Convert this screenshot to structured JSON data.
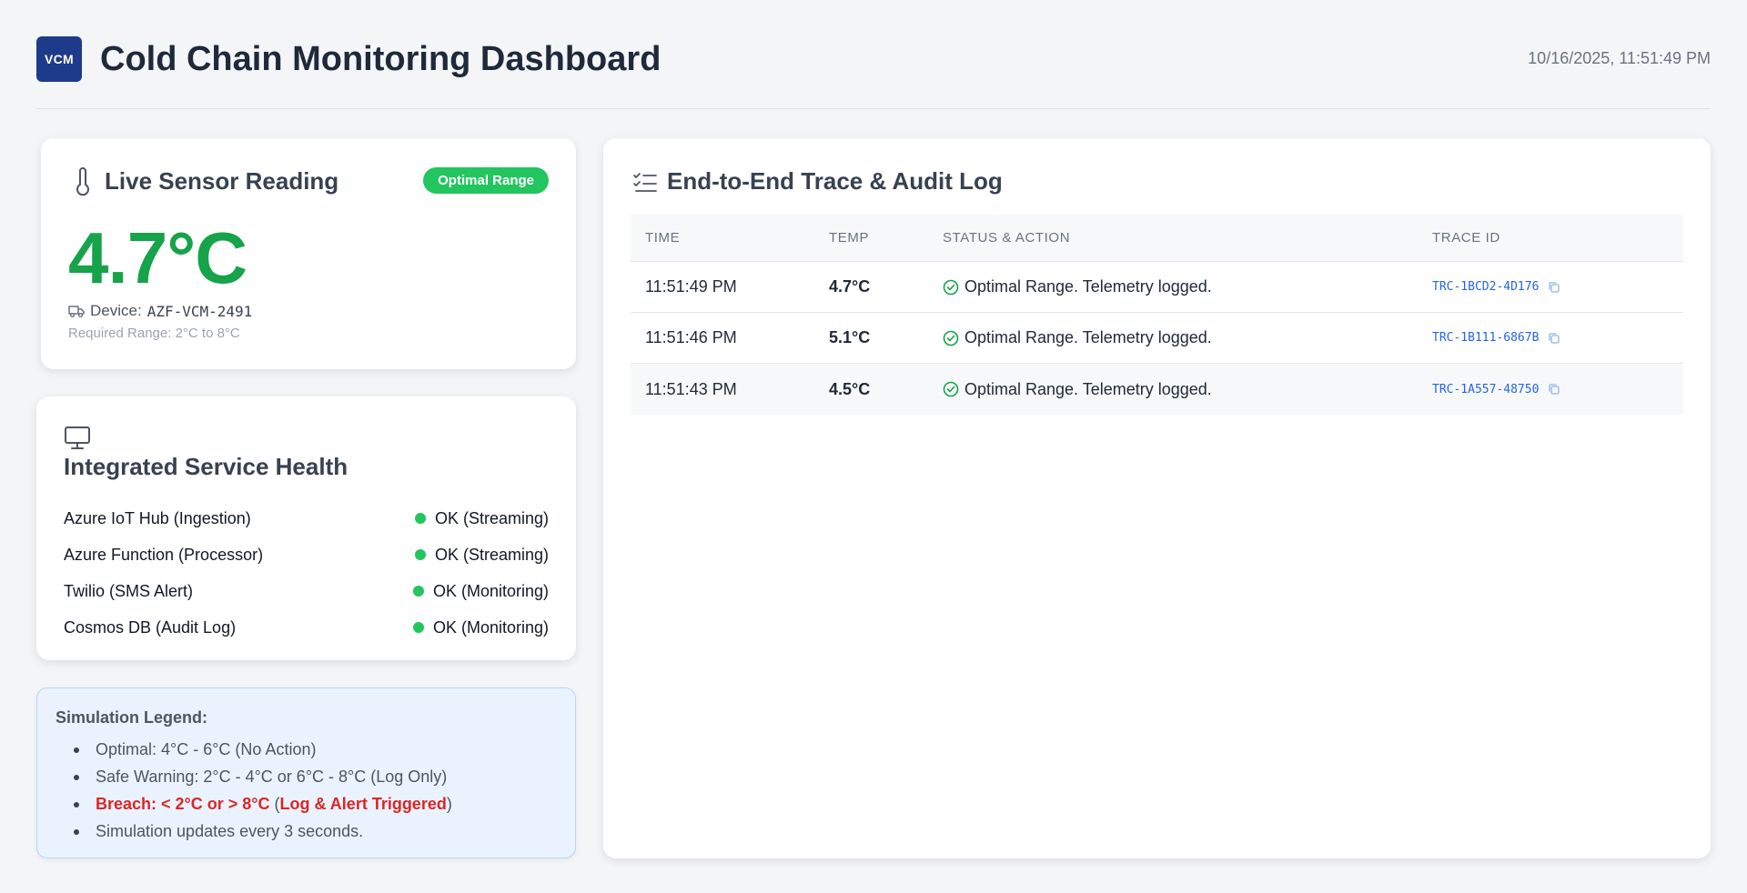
{
  "header": {
    "logo_text": "VCM",
    "title": "Cold Chain Monitoring Dashboard",
    "timestamp": "10/16/2025, 11:51:49 PM"
  },
  "sensor": {
    "title": "Live Sensor Reading",
    "badge": "Optimal Range",
    "temperature": "4.7°C",
    "device_label": "Device:",
    "device_id": "AZF-VCM-2491",
    "required_range": "Required Range: 2°C to 8°C"
  },
  "health": {
    "title": "Integrated Service Health",
    "services": [
      {
        "name": "Azure IoT Hub (Ingestion)",
        "status": "OK (Streaming)"
      },
      {
        "name": "Azure Function (Processor)",
        "status": "OK (Streaming)"
      },
      {
        "name": "Twilio (SMS Alert)",
        "status": "OK (Monitoring)"
      },
      {
        "name": "Cosmos DB (Audit Log)",
        "status": "OK (Monitoring)"
      }
    ]
  },
  "legend": {
    "title": "Simulation Legend:",
    "items": {
      "optimal": "Optimal: 4°C - 6°C (No Action)",
      "warning": "Safe Warning: 2°C - 4°C or 6°C - 8°C (Log Only)",
      "breach_label": "Breach: < 2°C or > 8°C",
      "breach_open": " (",
      "breach_action": "Log & Alert Triggered",
      "breach_close": ")",
      "updates": "Simulation updates every 3 seconds."
    }
  },
  "trace": {
    "title": "End-to-End Trace & Audit Log",
    "columns": [
      "TIME",
      "TEMP",
      "STATUS & ACTION",
      "TRACE ID"
    ],
    "rows": [
      {
        "time": "11:51:49 PM",
        "temp": "4.7°C",
        "status": "Optimal Range. Telemetry logged.",
        "trace_id": "TRC-1BCD2-4D176"
      },
      {
        "time": "11:51:46 PM",
        "temp": "5.1°C",
        "status": "Optimal Range. Telemetry logged.",
        "trace_id": "TRC-1B111-6867B"
      },
      {
        "time": "11:51:43 PM",
        "temp": "4.5°C",
        "status": "Optimal Range. Telemetry logged.",
        "trace_id": "TRC-1A557-48750"
      }
    ]
  },
  "colors": {
    "brand": "#1e3a8a",
    "ok": "#22c55e",
    "optimal_temp": "#16a34a",
    "breach": "#dc2626",
    "trace_link": "#2563eb"
  }
}
